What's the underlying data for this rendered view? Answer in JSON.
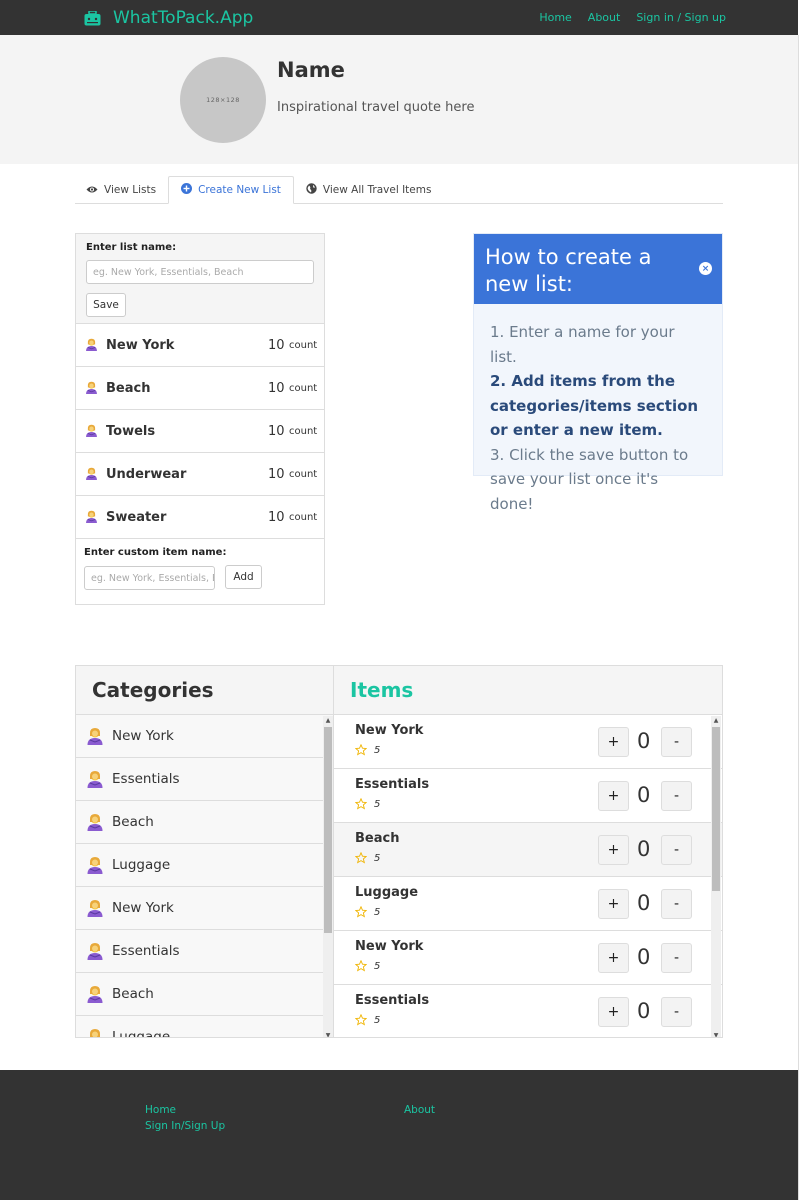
{
  "navbar": {
    "brand": "WhatToPack.App",
    "links": [
      "Home",
      "About",
      "Sign in / Sign up"
    ],
    "brand_color": "#1bc5a2"
  },
  "profile": {
    "avatar_text": "128×128",
    "name": "Name",
    "quote": "Inspirational travel quote here"
  },
  "tabs": [
    {
      "label": "View Lists",
      "icon": "eye-icon"
    },
    {
      "label": "Create New List",
      "icon": "plus-circle-icon",
      "active": true
    },
    {
      "label": "View All Travel Items",
      "icon": "globe-icon"
    }
  ],
  "new_list": {
    "name_label": "Enter list name:",
    "name_placeholder": "eg. New York, Essentials, Beach",
    "save_label": "Save",
    "entries": [
      {
        "name": "New York",
        "count": "10",
        "unit": "count"
      },
      {
        "name": "Beach",
        "count": "10",
        "unit": "count"
      },
      {
        "name": "Towels",
        "count": "10",
        "unit": "count"
      },
      {
        "name": "Underwear",
        "count": "10",
        "unit": "count"
      },
      {
        "name": "Sweater",
        "count": "10",
        "unit": "count"
      }
    ],
    "custom_label": "Enter custom item name:",
    "custom_placeholder": "eg. New York, Essentials, Beach",
    "add_label": "Add"
  },
  "help": {
    "title": "How to create a new list:",
    "close_icon": "close-icon",
    "step1": "1. Enter a name for your list.",
    "step2": "2. Add items from the categories/items section or enter a new item.",
    "step3": "3. Click the save button to save your list once it's done!",
    "accent": "#3b74d8"
  },
  "categories": {
    "title": "Categories",
    "items": [
      "New York",
      "Essentials",
      "Beach",
      "Luggage",
      "New York",
      "Essentials",
      "Beach",
      "Luggage"
    ]
  },
  "items": {
    "title": "Items",
    "rows": [
      {
        "name": "New York",
        "rating": "5",
        "qty": "0"
      },
      {
        "name": "Essentials",
        "rating": "5",
        "qty": "0"
      },
      {
        "name": "Beach",
        "rating": "5",
        "qty": "0"
      },
      {
        "name": "Luggage",
        "rating": "5",
        "qty": "0"
      },
      {
        "name": "New York",
        "rating": "5",
        "qty": "0"
      },
      {
        "name": "Essentials",
        "rating": "5",
        "qty": "0"
      }
    ],
    "plus_label": "+",
    "minus_label": "-"
  },
  "footer": {
    "home": "Home",
    "signin": "Sign In/Sign Up",
    "about": "About"
  }
}
